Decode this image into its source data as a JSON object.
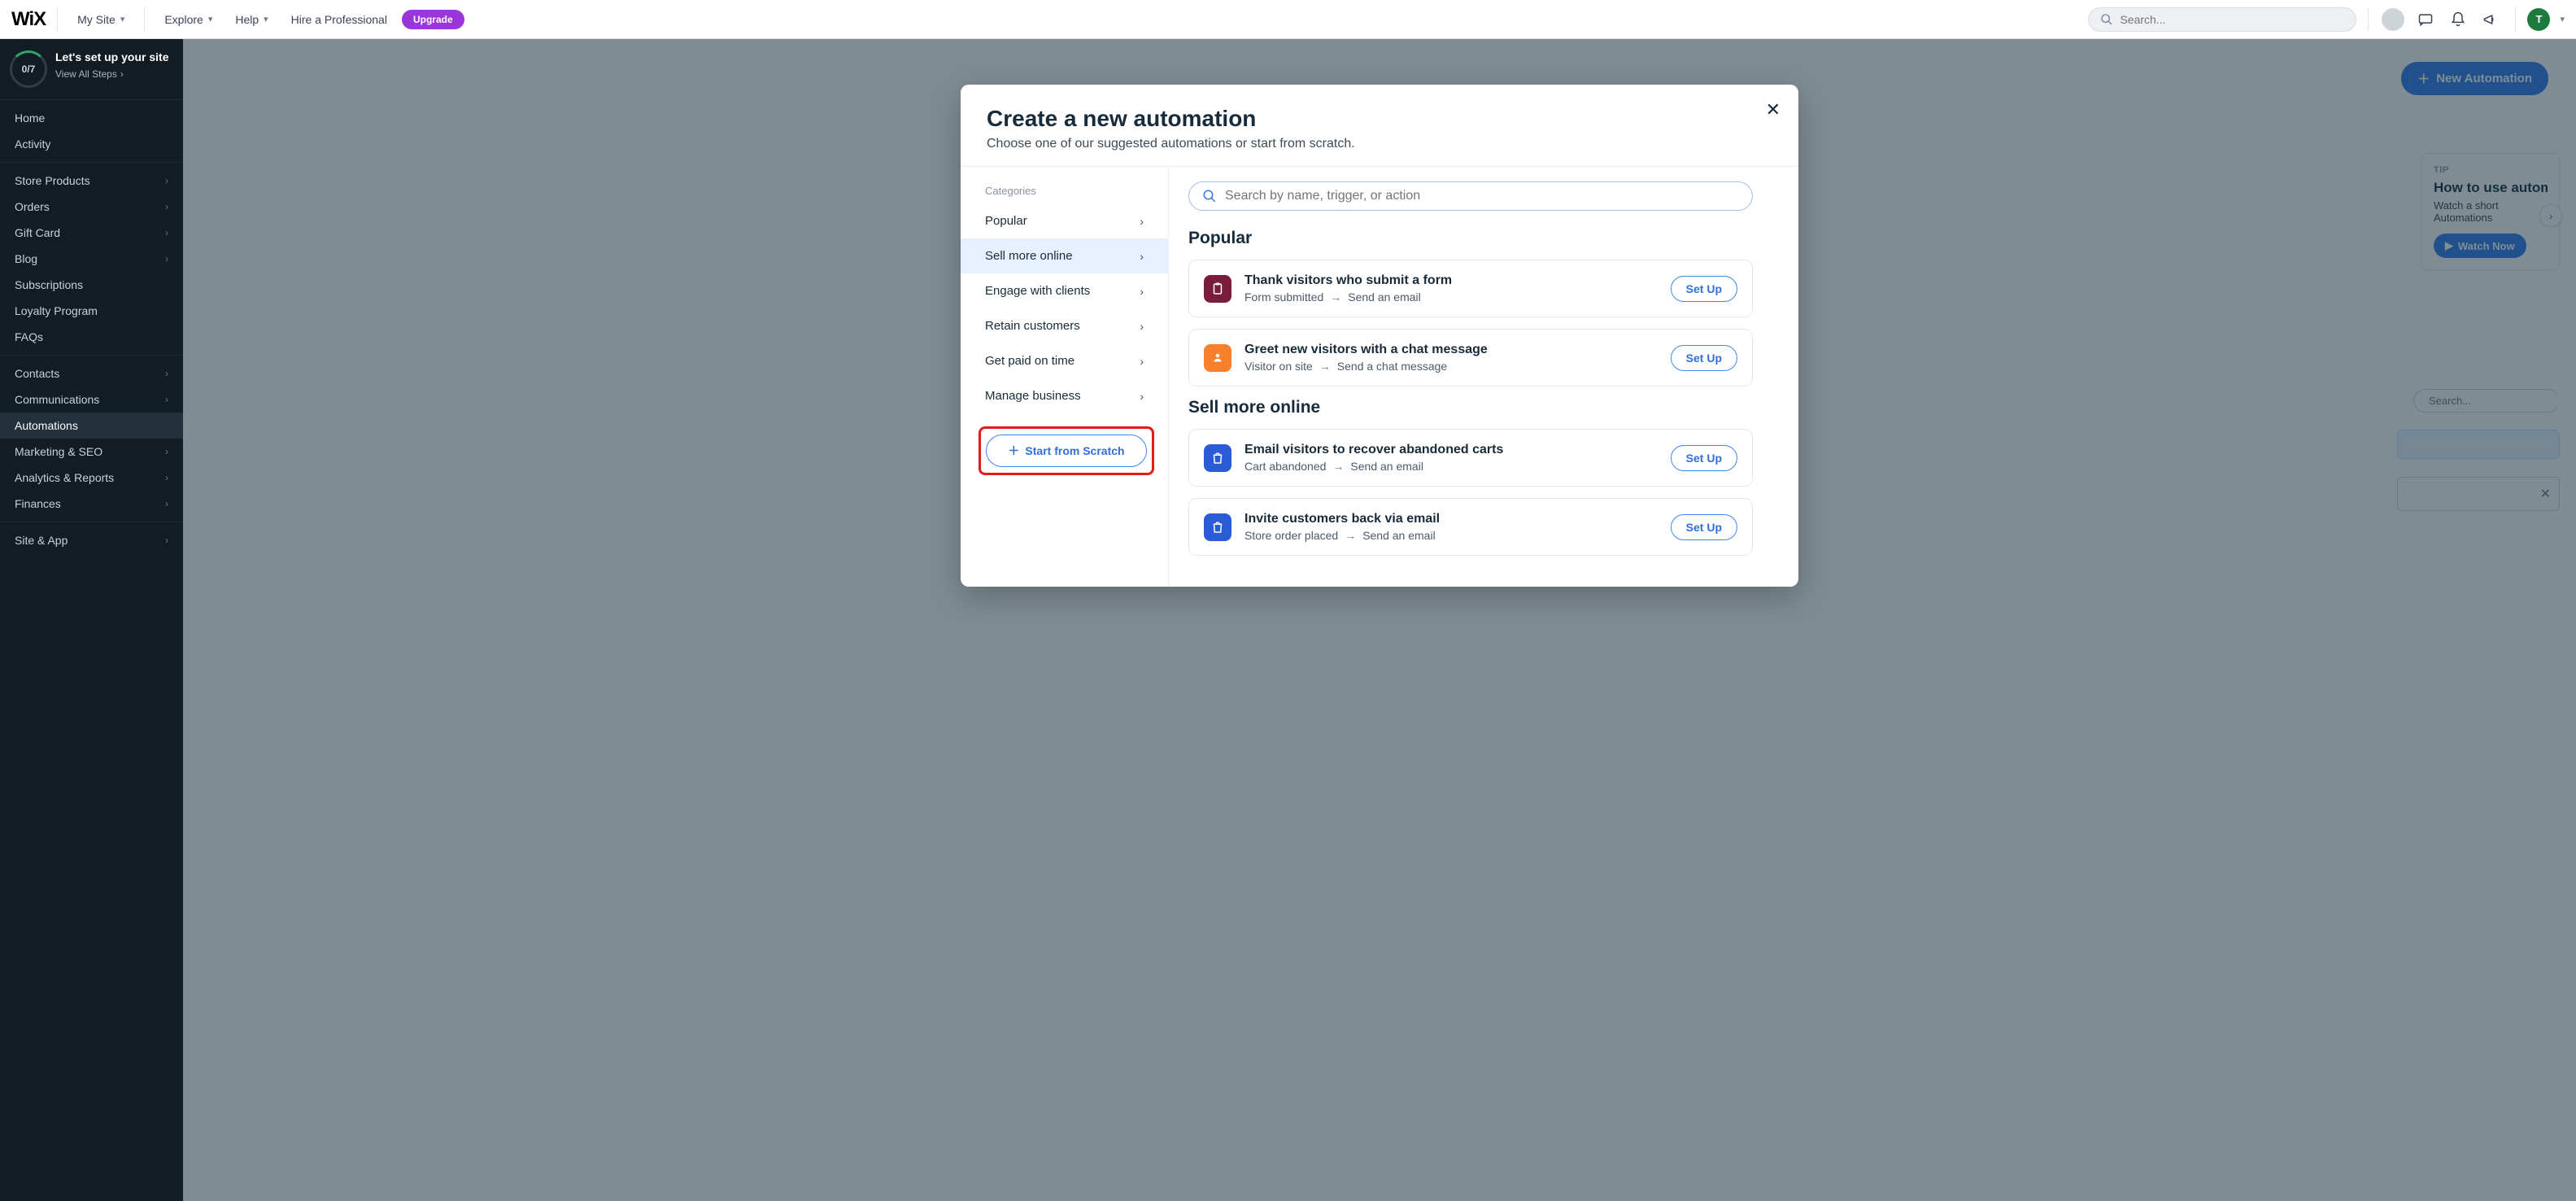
{
  "topbar": {
    "logo": "WiX",
    "site_switcher": "My Site",
    "menu": {
      "explore": "Explore",
      "help": "Help",
      "hire": "Hire a Professional"
    },
    "upgrade": "Upgrade",
    "search_placeholder": "Search...",
    "avatar_initial": "T"
  },
  "sidebar": {
    "setup": {
      "progress": "0/7",
      "title": "Let's set up your site",
      "view_all": "View All Steps"
    },
    "groups": [
      {
        "items": [
          {
            "label": "Home"
          },
          {
            "label": "Activity"
          }
        ]
      },
      {
        "items": [
          {
            "label": "Store Products",
            "expandable": true
          },
          {
            "label": "Orders",
            "expandable": true
          },
          {
            "label": "Gift Card",
            "expandable": true
          },
          {
            "label": "Blog",
            "expandable": true
          },
          {
            "label": "Subscriptions"
          },
          {
            "label": "Loyalty Program"
          },
          {
            "label": "FAQs"
          }
        ]
      },
      {
        "items": [
          {
            "label": "Contacts",
            "expandable": true
          },
          {
            "label": "Communications",
            "expandable": true
          },
          {
            "label": "Automations",
            "active": true
          },
          {
            "label": "Marketing & SEO",
            "expandable": true
          },
          {
            "label": "Analytics & Reports",
            "expandable": true
          },
          {
            "label": "Finances",
            "expandable": true
          }
        ]
      },
      {
        "items": [
          {
            "label": "Site & App",
            "expandable": true
          }
        ]
      }
    ]
  },
  "page": {
    "new_automation": "New Automation",
    "tip": {
      "label": "TIP",
      "title": "How to use autom",
      "sub1": "Watch a short",
      "sub2": "Automations",
      "watch": "Watch Now"
    },
    "mini_search_placeholder": "Search..."
  },
  "modal": {
    "title": "Create a new automation",
    "subtitle": "Choose one of our suggested automations or start from scratch.",
    "categories_label": "Categories",
    "categories": [
      {
        "label": "Popular"
      },
      {
        "label": "Sell more online",
        "active": true
      },
      {
        "label": "Engage with clients"
      },
      {
        "label": "Retain customers"
      },
      {
        "label": "Get paid on time"
      },
      {
        "label": "Manage business"
      }
    ],
    "start_scratch": "Start from Scratch",
    "search_placeholder": "Search by name, trigger, or action",
    "sections": [
      {
        "title": "Popular",
        "icon_class": "ic-maroon",
        "items": [
          {
            "icon": "clipboard-icon",
            "title": "Thank visitors who submit a form",
            "trigger": "Form submitted",
            "action": "Send an email",
            "btn": "Set Up"
          },
          {
            "icon": "chat-person-icon",
            "icon_class": "ic-orange",
            "title": "Greet new visitors with a chat message",
            "trigger": "Visitor on site",
            "action": "Send a chat message",
            "btn": "Set Up"
          }
        ]
      },
      {
        "title": "Sell more online",
        "icon_class": "ic-blue",
        "items": [
          {
            "icon": "shopping-bag-icon",
            "title": "Email visitors to recover abandoned carts",
            "trigger": "Cart abandoned",
            "action": "Send an email",
            "btn": "Set Up"
          },
          {
            "icon": "shopping-bag-icon",
            "title": "Invite customers back via email",
            "trigger": "Store order placed",
            "action": "Send an email",
            "btn": "Set Up"
          }
        ]
      }
    ]
  }
}
